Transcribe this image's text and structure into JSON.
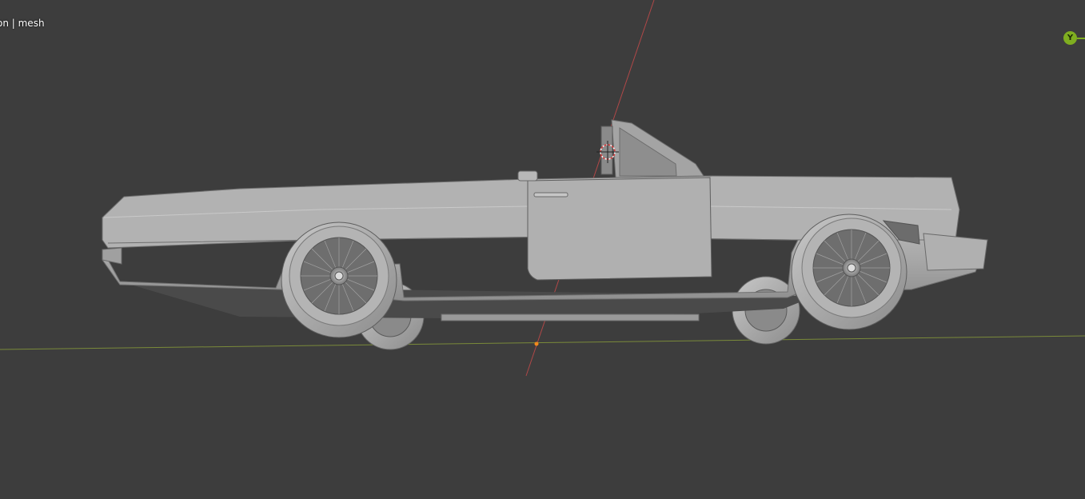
{
  "viewport": {
    "object_info": "on | mesh",
    "navigation_gizmo": {
      "y_axis_label": "Y",
      "y_axis_color": "#7fae20"
    },
    "background_color": "#3d3d3d",
    "axis_colors": {
      "x_axis": "#b34a4a",
      "y_axis": "#8a9a3a"
    },
    "origin_color": "#f08a1c",
    "object": {
      "type": "mesh",
      "description_icon": "car-mesh"
    }
  }
}
